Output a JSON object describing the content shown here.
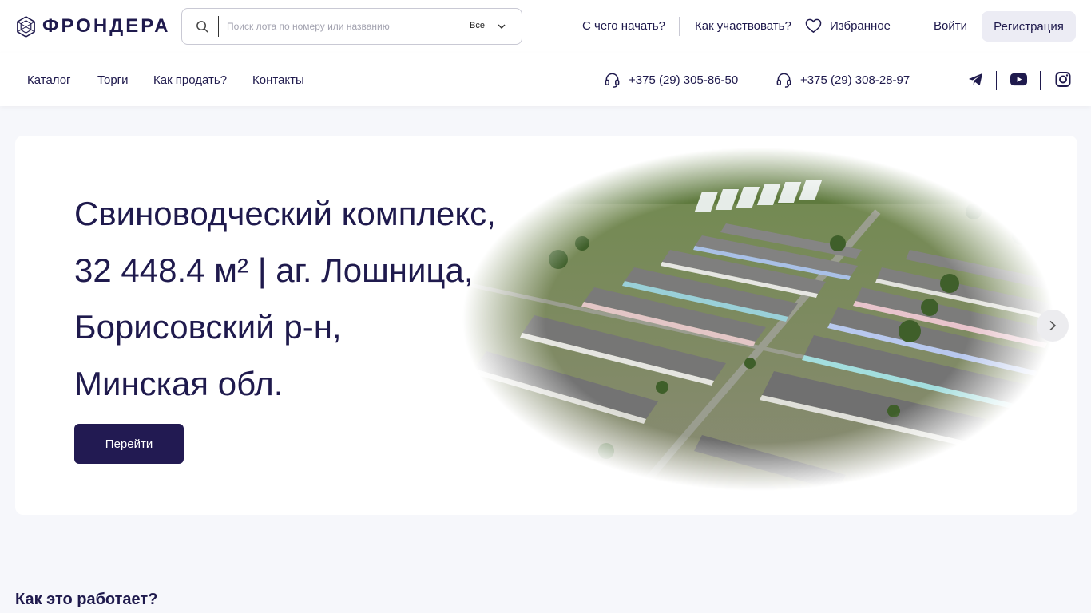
{
  "header": {
    "logo_text": "ФРОНДЕРА",
    "search": {
      "placeholder": "Поиск лота по номеру или названию",
      "scope": "Все"
    },
    "links": {
      "how_start": "С чего начать?",
      "how_participate": "Как участвовать?",
      "favorites": "Избранное"
    },
    "login": "Войти",
    "register": "Регистрация"
  },
  "nav": {
    "items": [
      "Каталог",
      "Торги",
      "Как продать?",
      "Контакты"
    ],
    "phones": [
      "+375 (29) 305-86-50",
      "+375 (29) 308-28-97"
    ]
  },
  "hero": {
    "title_lines": [
      "Свиноводческий комплекс,",
      "32 448.4 м² | аг. Лошница,",
      "Борисовский р-н,",
      "Минская обл."
    ],
    "button": "Перейти"
  },
  "section": {
    "how_it_works": "Как это работает?"
  },
  "colors": {
    "brand": "#1f1a4d",
    "button": "#221a52",
    "register_bg": "#ececf4"
  }
}
